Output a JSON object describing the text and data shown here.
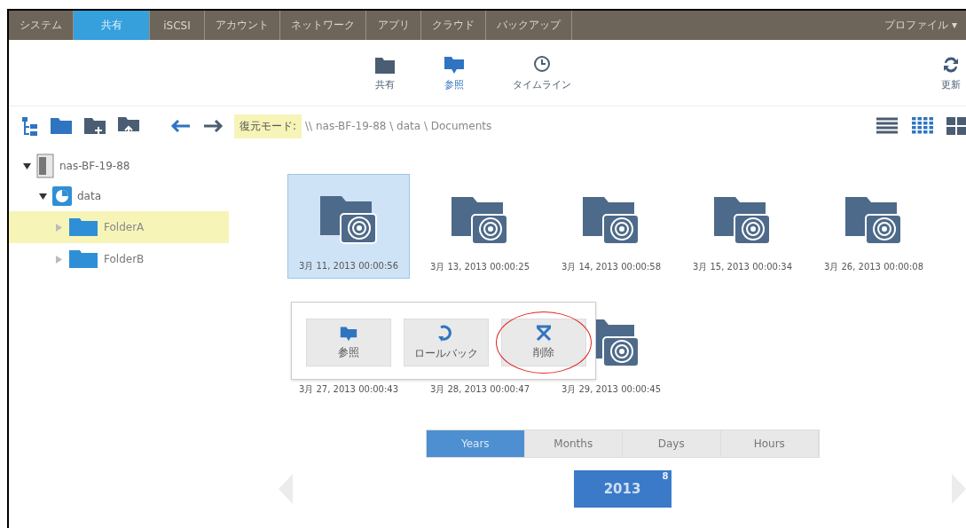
{
  "nav_tabs": [
    {
      "label": "システム",
      "selected": false
    },
    {
      "label": "共有",
      "selected": true
    },
    {
      "label": "iSCSI",
      "selected": false
    },
    {
      "label": "アカウント",
      "selected": false
    },
    {
      "label": "ネットワーク",
      "selected": false
    },
    {
      "label": "アプリ",
      "selected": false
    },
    {
      "label": "クラウド",
      "selected": false
    },
    {
      "label": "バックアップ",
      "selected": false
    }
  ],
  "profile_menu": "プロファイル ▾",
  "sub_tabs": [
    {
      "label": "共有",
      "kind": "folder",
      "selected": false
    },
    {
      "label": "参照",
      "kind": "browse",
      "selected": true
    },
    {
      "label": "タイムライン",
      "kind": "clock",
      "selected": false
    }
  ],
  "refresh": "更新",
  "breadcrumb": {
    "mode": "復元モード:",
    "path": "\\\\ nas-BF-19-88 \\ data \\ Documents"
  },
  "view_modes": [
    {
      "kind": "list",
      "selected": false
    },
    {
      "kind": "grid",
      "selected": true
    },
    {
      "kind": "tiles",
      "selected": false
    }
  ],
  "tree": [
    {
      "label": "nas-BF-19-88",
      "kind": "device",
      "expanded": true,
      "selected": false,
      "children": [
        {
          "label": "data",
          "kind": "volume",
          "expanded": true,
          "selected": false,
          "children": [
            {
              "label": "FolderA",
              "kind": "folder",
              "expanded": false,
              "selected": true
            },
            {
              "label": "FolderB",
              "kind": "folder",
              "expanded": false,
              "selected": false
            }
          ]
        }
      ]
    }
  ],
  "snapshots": [
    {
      "label": "3月 11, 2013 00:00:56",
      "selected": true
    },
    {
      "label": "3月 13, 2013 00:00:25",
      "selected": false
    },
    {
      "label": "3月 14, 2013 00:00:58",
      "selected": false
    },
    {
      "label": "3月 15, 2013 00:00:34",
      "selected": false
    },
    {
      "label": "3月 26, 2013 00:00:08",
      "selected": false
    },
    {
      "label": "3月 27, 2013 00:00:43",
      "selected": false
    },
    {
      "label": "3月 28, 2013 00:00:47",
      "selected": false
    },
    {
      "label": "3月 29, 2013 00:00:45",
      "selected": false
    }
  ],
  "popup_actions": [
    {
      "label": "参照",
      "kind": "browse",
      "highlighted": false
    },
    {
      "label": "ロールバック",
      "kind": "rollback",
      "highlighted": false
    },
    {
      "label": "削除",
      "kind": "delete",
      "highlighted": true
    }
  ],
  "scales": [
    {
      "label": "Years",
      "selected": true
    },
    {
      "label": "Months",
      "selected": false
    },
    {
      "label": "Days",
      "selected": false
    },
    {
      "label": "Hours",
      "selected": false
    }
  ],
  "year": {
    "label": "2013",
    "count": "8"
  }
}
